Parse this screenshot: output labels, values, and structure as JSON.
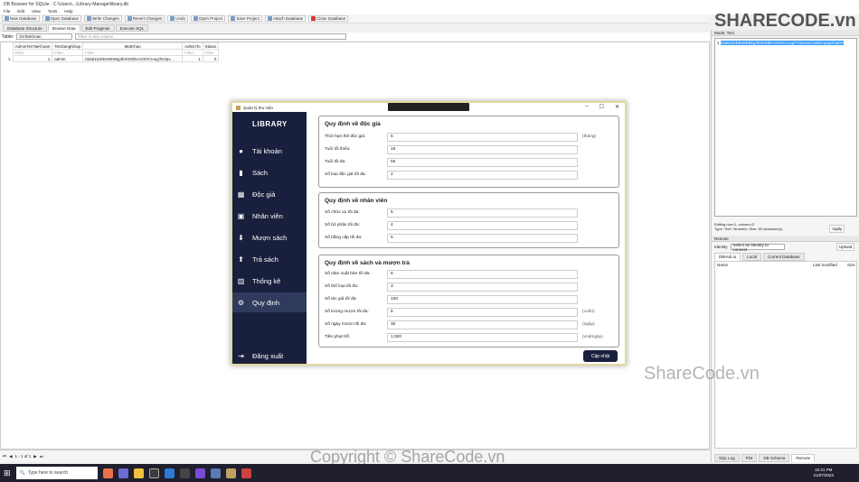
{
  "browser": {
    "title": "DB Browser for SQLite - C:\\Users\\...\\Library-Manage\\library.db",
    "menu": [
      "File",
      "Edit",
      "View",
      "Tools",
      "Help"
    ],
    "toolbar": [
      "New Database",
      "Open Database",
      "Write Changes",
      "Revert Changes",
      "Undo",
      "Open Project",
      "Save Project",
      "Attach Database",
      "Close Database"
    ],
    "tabs": [
      "Database Structure",
      "Browse Data",
      "Edit Pragmas",
      "Execute SQL"
    ],
    "table_label": "Table:",
    "table_value": "DsTaiKhoan",
    "filter_placeholder": "Filter in any column",
    "columns": [
      "AdminTenTaiKhoan",
      "TenDangNhap",
      "MatKhau",
      "AdminTo",
      "Status"
    ],
    "filter_text": "Filter",
    "row": [
      "1",
      "admin",
      "02a5111EEe5E86g3bX0S8bAoOOCrougTcOpv...",
      "1",
      "0"
    ],
    "pager": "1 - 1 of 1",
    "right_header": "Mode: Text",
    "edit_value": "02a5111EEe5E86g3bX0S8bAoOOCrougTcOpv5nCaaEicq4gShaDD",
    "edit_status1": "Editing row=1, column=3",
    "edit_status2": "Type: Text / Numeric; Size: 60 character(s)",
    "apply": "Apply",
    "remote": "Remote",
    "identity": "Identity",
    "identity_value": "Select an identity to connect",
    "upload": "Upload",
    "remote_tabs": [
      "DBHub.io",
      "Local",
      "Current Database"
    ],
    "remote_cols": [
      "Name",
      "Last modified",
      "Size"
    ],
    "bottom_tabs": [
      "SQL Log",
      "Plot",
      "DB Schema",
      "Remote"
    ],
    "encoding": "UTF-8"
  },
  "watermark": {
    "logo": "SHARECODE.vn",
    "mid": "ShareCode.vn",
    "bottom": "Copyright © ShareCode.vn"
  },
  "taskbar": {
    "search": "Type here to search",
    "time": "10:31 PM",
    "date": "21/07/2023"
  },
  "app": {
    "window_title": "Quản lý thư viện",
    "brand": "LIBRARY",
    "nav": [
      {
        "label": "Tài khoản",
        "icon": "user-circle-icon"
      },
      {
        "label": "Sách",
        "icon": "book-icon"
      },
      {
        "label": "Độc giả",
        "icon": "reader-group-icon"
      },
      {
        "label": "Nhân viên",
        "icon": "staff-badge-icon"
      },
      {
        "label": "Mượn sách",
        "icon": "borrow-icon"
      },
      {
        "label": "Trả sách",
        "icon": "return-icon"
      },
      {
        "label": "Thống kê",
        "icon": "chart-icon"
      },
      {
        "label": "Quy định",
        "icon": "gear-icon"
      }
    ],
    "active_nav": "Quy định",
    "logout": "Đăng xuất",
    "sections": [
      {
        "title": "Quy định về độc giả",
        "fields": [
          {
            "label": "Thời hạn thẻ độc giả:",
            "value": "6",
            "unit": "(tháng)"
          },
          {
            "label": "Tuổi tối thiểu:",
            "value": "18",
            "unit": ""
          },
          {
            "label": "Tuổi tối đa:",
            "value": "55",
            "unit": ""
          },
          {
            "label": "Số loại độc giả tối đa:",
            "value": "2",
            "unit": ""
          }
        ]
      },
      {
        "title": "Quy định về nhân viên",
        "fields": [
          {
            "label": "Số chức vụ tối đa:",
            "value": "5",
            "unit": ""
          },
          {
            "label": "Số bộ phận tối đa:",
            "value": "4",
            "unit": ""
          },
          {
            "label": "Số bằng cấp tối đa:",
            "value": "6",
            "unit": ""
          }
        ]
      },
      {
        "title": "Quy định về sách và mượn trả",
        "fields": [
          {
            "label": "Số năm xuất bản tối đa:",
            "value": "8",
            "unit": ""
          },
          {
            "label": "Số thể loại tối đa:",
            "value": "3",
            "unit": ""
          },
          {
            "label": "Số tác giả tối đa:",
            "value": "100",
            "unit": ""
          },
          {
            "label": "Số lượng mượn tối đa:",
            "value": "5",
            "unit": "(cuốn)"
          },
          {
            "label": "Số ngày mượn tối đa:",
            "value": "30",
            "unit": "(ngày)"
          },
          {
            "label": "Tiền phạt trễ:",
            "value": "1,000",
            "unit": "(vnd/ngày)"
          }
        ]
      }
    ],
    "update_button": "Cập nhật"
  }
}
